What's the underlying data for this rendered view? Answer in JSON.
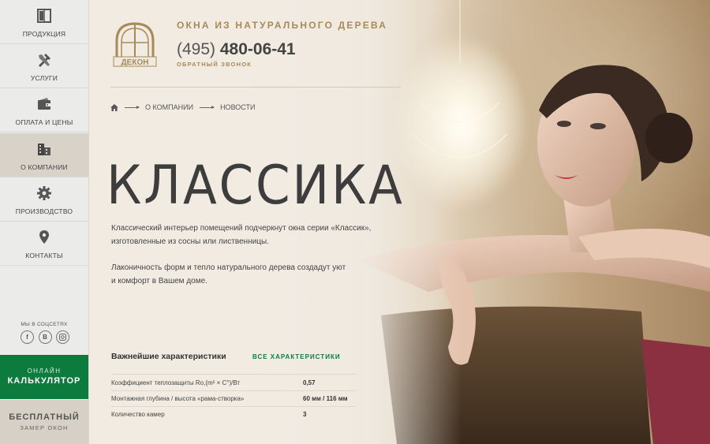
{
  "sidebar": {
    "items": [
      {
        "label": "ПРОДУКЦИЯ",
        "icon": "window-icon"
      },
      {
        "label": "УСЛУГИ",
        "icon": "tools-icon"
      },
      {
        "label": "ОПЛАТА И ЦЕНЫ",
        "icon": "wallet-icon"
      },
      {
        "label": "О КОМПАНИИ",
        "icon": "building-icon",
        "active": true
      },
      {
        "label": "ПРОИЗВОДСТВО",
        "icon": "gear-icon"
      },
      {
        "label": "КОНТАКТЫ",
        "icon": "location-pin-icon"
      }
    ],
    "social_title": "МЫ В СОЦСЕТЯХ",
    "social": [
      "f",
      "В",
      "instagram"
    ],
    "calc": {
      "small": "ОНЛАЙН",
      "big": "КАЛЬКУЛЯТОР"
    },
    "measure": {
      "big": "БЕСПЛАТНЫЙ",
      "small": "ЗАМЕР ОКОН"
    }
  },
  "header": {
    "logo_text": "ДЕКОН",
    "tagline": "ОКНА ИЗ НАТУРАЛЬНОГО ДЕРЕВА",
    "phone_code": "(495)",
    "phone_number": "480-06-41",
    "callback": "ОБРАТНЫЙ ЗВОНОК"
  },
  "breadcrumb": {
    "items": [
      "О КОМПАНИИ",
      "НОВОСТИ"
    ]
  },
  "hero": {
    "title": "КЛАССИКА",
    "paragraph1_line1": "Классический интерьер помещений подчеркнут окна серии «Классик»,",
    "paragraph1_line2": "изготовленные из сосны или лиственницы.",
    "paragraph2_line1": "Лаконичность форм и тепло натурального дерева создадут уют",
    "paragraph2_line2": "и комфорт в Вашем доме."
  },
  "features": {
    "title": "Важнейшие характеристики",
    "all_link": "ВСЕ ХАРАКТЕРИСТИКИ",
    "rows": [
      {
        "name": "Коэффициент теплозащиты Ro,(m² × C°)/Вт",
        "value": "0,57"
      },
      {
        "name": "Монтажная глубина / высота «рама-створка»",
        "value": "60 мм / 116 мм"
      },
      {
        "name": "Количество камер",
        "value": "3"
      }
    ]
  },
  "colors": {
    "accent_green": "#0d7a3e",
    "gold": "#a88a58",
    "sidebar_bg": "#ebebea"
  }
}
